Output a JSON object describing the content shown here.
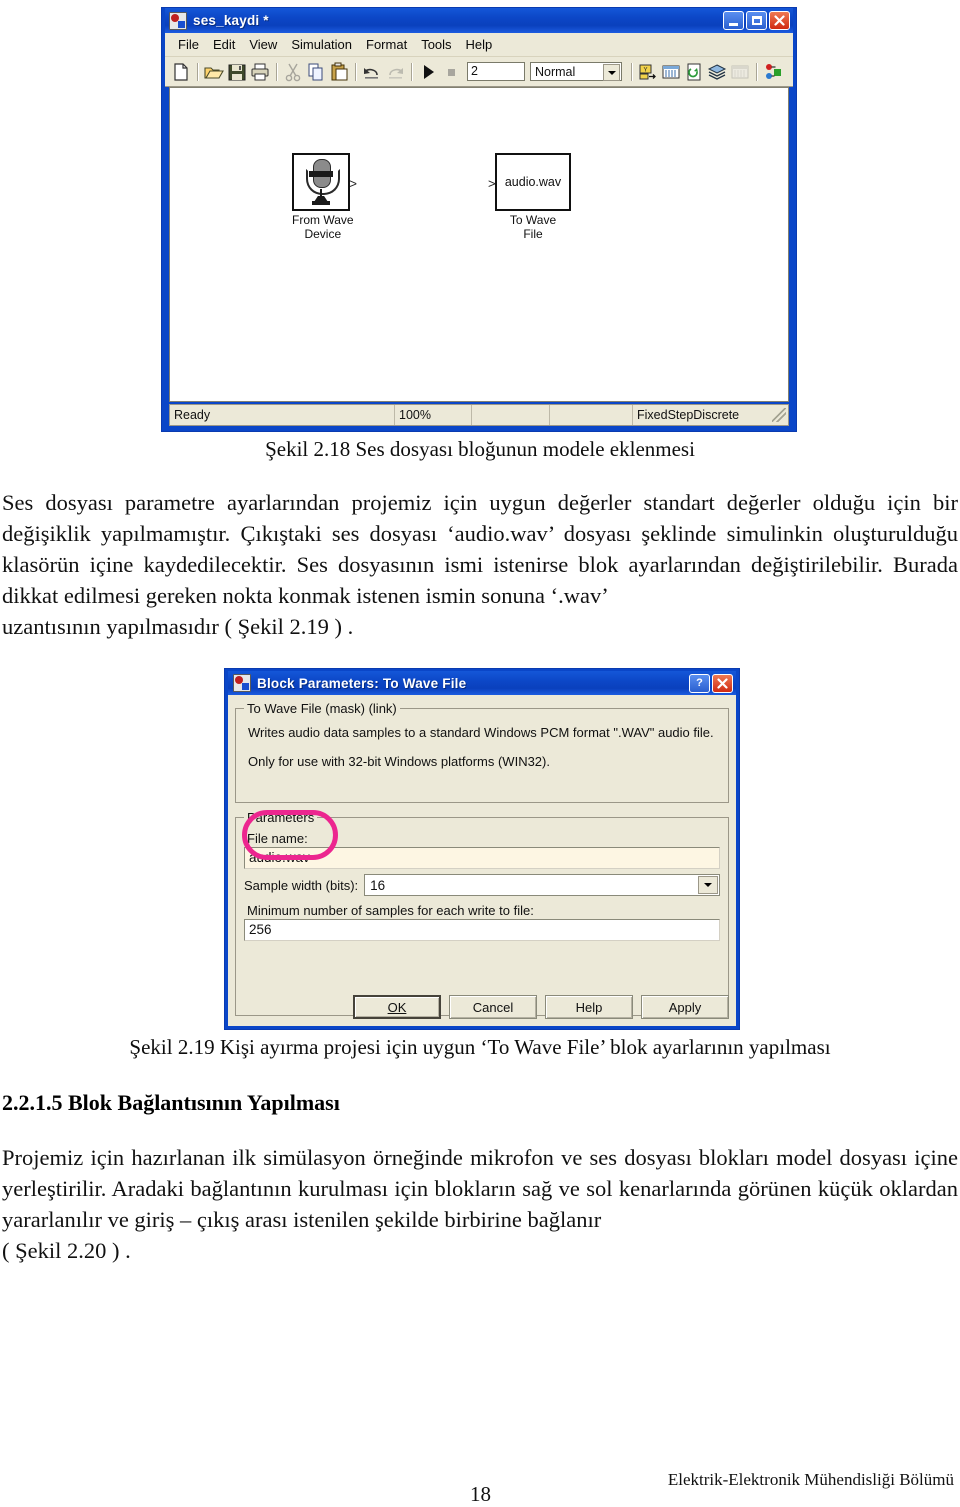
{
  "simulink_window": {
    "title": "ses_kaydi *",
    "title_icon": "simulink-model-icon",
    "window_buttons": {
      "minimize": "–",
      "maximize": "❐",
      "close": "✕"
    },
    "menus": [
      "File",
      "Edit",
      "View",
      "Simulation",
      "Format",
      "Tools",
      "Help"
    ],
    "toolbar": {
      "icons": [
        "new-model-icon",
        "open-model-icon",
        "save-icon",
        "print-icon",
        "cut-icon",
        "copy-icon",
        "paste-icon",
        "undo-icon",
        "redo-icon",
        "start-simulation-icon",
        "stop-simulation-icon"
      ],
      "stop_time_value": "2",
      "sim_mode_value": "Normal",
      "right_icons": [
        "update-diagram-icon",
        "library-browser-icon",
        "model-explorer-icon",
        "model-hierarchy-icon",
        "toggle-debug-icon",
        "go-to-parent-icon"
      ]
    },
    "canvas": {
      "blocks": [
        {
          "name": "From Wave Device",
          "label_line1": "From Wave",
          "label_line2": "Device",
          "icon": "microphone-icon",
          "output_port": ">"
        },
        {
          "name": "To Wave File",
          "label_line1": "To Wave",
          "label_line2": "File",
          "inner_text": "audio.wav",
          "input_port": ">"
        }
      ]
    },
    "statusbar": {
      "state": "Ready",
      "zoom": "100%",
      "cell3": "",
      "cell4": "",
      "solver": "FixedStepDiscrete"
    }
  },
  "figure_2_18_caption": "Şekil 2.18  Ses dosyası bloğunun modele eklenmesi",
  "paragraph_1": "Ses dosyası parametre ayarlarından projemiz için uygun değerler standart değerler olduğu için bir değişiklik yapılmamıştır. Çıkıştaki ses dosyası ‘audio.wav’ dosyası şeklinde simulinkin oluşturulduğu klasörün içine kaydedilecektir. Ses dosyasının ismi istenirse blok ayarlarından değiştirilebilir. Burada dikkat edilmesi gereken nokta konmak istenen ismin sonuna ‘.wav’",
  "paragraph_1_last_line": "uzantısının yapılmasıdır ( Şekil 2.19 ) .",
  "dialog": {
    "title": "Block Parameters: To Wave File",
    "title_icon": "simulink-block-icon",
    "help_button": "?",
    "close_button": "✕",
    "mask_group_legend": "To Wave File (mask) (link)",
    "description_line1": "Writes audio data samples to a standard Windows PCM format \".WAV\" audio file.",
    "description_line2": "Only for use with 32-bit Windows platforms (WIN32).",
    "parameters_legend": "Parameters",
    "file_name_label": "File name:",
    "file_name_value": "audio.wav",
    "sample_width_label": "Sample width (bits):",
    "sample_width_value": "16",
    "min_samples_label": "Minimum number of samples for each write to file:",
    "min_samples_value": "256",
    "buttons": {
      "ok": "OK",
      "cancel": "Cancel",
      "help": "Help",
      "apply": "Apply"
    },
    "annotation_color": "#ec268f"
  },
  "figure_2_19_caption": "Şekil 2.19  Kişi ayırma projesi için uygun ‘To Wave File’ blok ayarlarının yapılması",
  "section_heading": "2.2.1.5 Blok Bağlantısının Yapılması",
  "paragraph_2": "Projemiz için hazırlanan ilk simülasyon örneğinde mikrofon ve ses dosyası blokları model dosyası içine yerleştirilir. Aradaki bağlantının kurulması için blokların sağ ve sol kenarlarında görünen küçük oklardan yararlanılır ve giriş – çıkış arası istenilen şekilde birbirine bağlanır",
  "paragraph_2_last_line": "( Şekil 2.20 ) .",
  "footer": {
    "page_number": "18",
    "department": "Elektrik-Elektronik Mühendisliği Bölümü"
  }
}
